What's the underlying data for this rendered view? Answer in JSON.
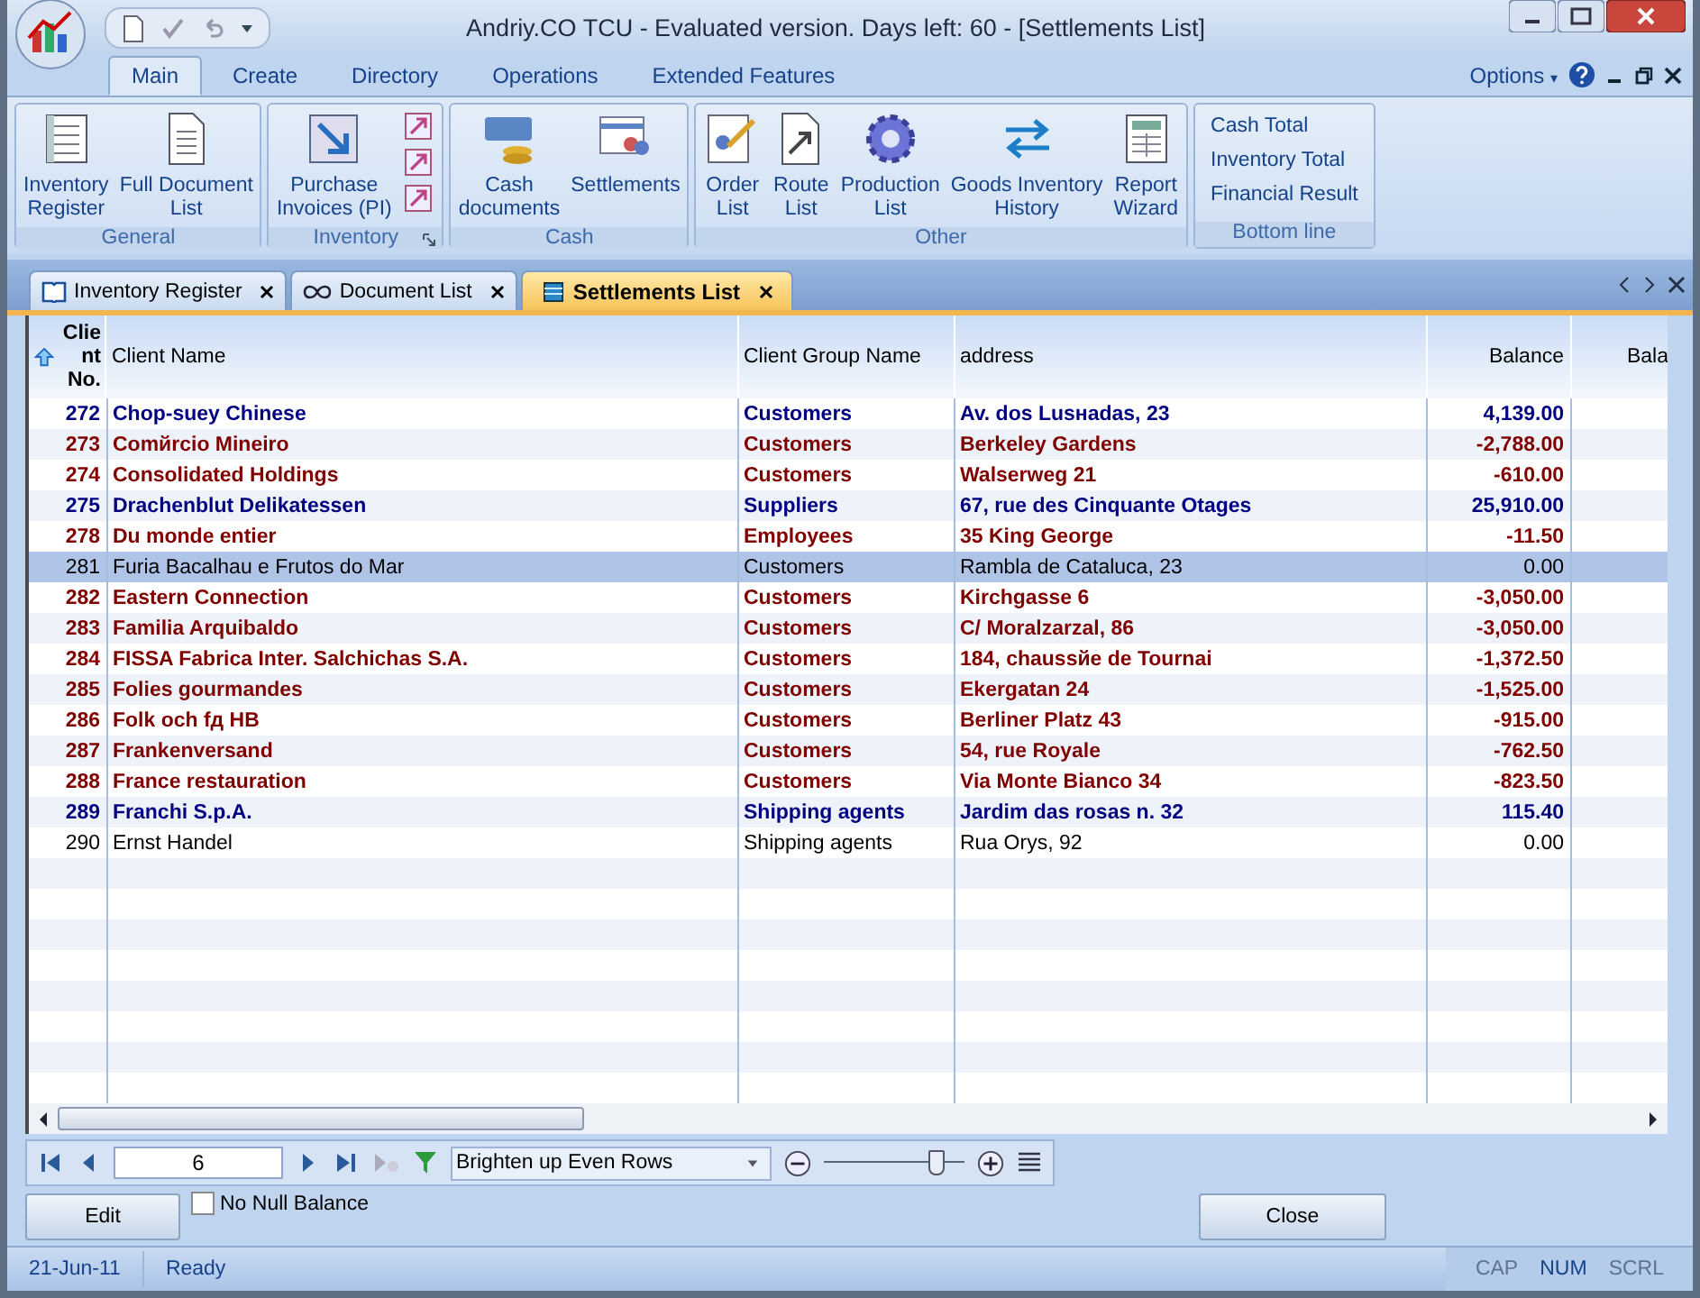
{
  "window": {
    "title": "Andriy.CO TCU - Evaluated version. Days left: 60 - [Settlements List]"
  },
  "ribbon_tabs": [
    {
      "label": "Main",
      "selected": true
    },
    {
      "label": "Create",
      "selected": false
    },
    {
      "label": "Directory",
      "selected": false
    },
    {
      "label": "Operations",
      "selected": false
    },
    {
      "label": "Extended Features",
      "selected": false
    }
  ],
  "options": {
    "label": "Options",
    "caret": "▾"
  },
  "ribbon_groups": [
    {
      "title": "General",
      "launcher": false,
      "buttons": [
        "Inventory\nRegister",
        "Full Document\nList"
      ]
    },
    {
      "title": "Inventory",
      "launcher": true,
      "buttons": [
        "Purchase\nInvoices (PI)"
      ]
    },
    {
      "title": "Cash",
      "launcher": false,
      "buttons": [
        "Cash\ndocuments",
        "Settlements"
      ]
    },
    {
      "title": "Other",
      "launcher": false,
      "buttons": [
        "Order\nList",
        "Route\nList",
        "Production\nList",
        "Goods Inventory\nHistory",
        "Report\nWizard"
      ]
    },
    {
      "title": "Bottom line",
      "launcher": false,
      "links": [
        "Cash Total",
        "Inventory Total",
        "Financial Result"
      ]
    }
  ],
  "doc_tabs": [
    {
      "label": "Inventory Register",
      "selected": false
    },
    {
      "label": "Document List",
      "selected": false
    },
    {
      "label": "Settlements List",
      "selected": true
    }
  ],
  "table": {
    "columns": [
      "Client No.",
      "Client Name",
      "Client Group Name",
      "address",
      "Balance",
      "Bala"
    ],
    "rows": [
      {
        "no": "272",
        "name": "Chop-suey Chinese",
        "group": "Customers",
        "address": "Av. dos Lusнadas, 23",
        "balance": "4,139.00",
        "color": "#000080",
        "bold": true,
        "selected": false
      },
      {
        "no": "273",
        "name": "Comйrcio Mineiro",
        "group": "Customers",
        "address": "Berkeley Gardens",
        "balance": "-2,788.00",
        "color": "#800000",
        "bold": true,
        "selected": false
      },
      {
        "no": "274",
        "name": "Consolidated Holdings",
        "group": "Customers",
        "address": "Walserweg 21",
        "balance": "-610.00",
        "color": "#800000",
        "bold": true,
        "selected": false
      },
      {
        "no": "275",
        "name": "Drachenblut Delikatessen",
        "group": "Suppliers",
        "address": "67, rue des Cinquante Otages",
        "balance": "25,910.00",
        "color": "#000080",
        "bold": true,
        "selected": false
      },
      {
        "no": "278",
        "name": "Du monde entier",
        "group": "Employees",
        "address": "35 King George",
        "balance": "-11.50",
        "color": "#800000",
        "bold": true,
        "selected": false
      },
      {
        "no": "281",
        "name": "Furia Bacalhau e Frutos do Mar",
        "group": "Customers",
        "address": "Rambla de Cataluca, 23",
        "balance": "0.00",
        "color": "#000000",
        "bold": false,
        "selected": true
      },
      {
        "no": "282",
        "name": "Eastern Connection",
        "group": "Customers",
        "address": "Kirchgasse 6",
        "balance": "-3,050.00",
        "color": "#800000",
        "bold": true,
        "selected": false
      },
      {
        "no": "283",
        "name": "Familia Arquibaldo",
        "group": "Customers",
        "address": "C/ Moralzarzal, 86",
        "balance": "-3,050.00",
        "color": "#800000",
        "bold": true,
        "selected": false
      },
      {
        "no": "284",
        "name": "FISSA Fabrica Inter. Salchichas S.A.",
        "group": "Customers",
        "address": "184, chaussйe de Tournai",
        "balance": "-1,372.50",
        "color": "#800000",
        "bold": true,
        "selected": false
      },
      {
        "no": "285",
        "name": "Folies gourmandes",
        "group": "Customers",
        "address": "Ekergatan 24",
        "balance": "-1,525.00",
        "color": "#800000",
        "bold": true,
        "selected": false
      },
      {
        "no": "286",
        "name": "Folk och fд HB",
        "group": "Customers",
        "address": "Berliner Platz 43",
        "balance": "-915.00",
        "color": "#800000",
        "bold": true,
        "selected": false
      },
      {
        "no": "287",
        "name": "Frankenversand",
        "group": "Customers",
        "address": "54, rue Royale",
        "balance": "-762.50",
        "color": "#800000",
        "bold": true,
        "selected": false
      },
      {
        "no": "288",
        "name": "France restauration",
        "group": "Customers",
        "address": "Via Monte Bianco 34",
        "balance": "-823.50",
        "color": "#800000",
        "bold": true,
        "selected": false
      },
      {
        "no": "289",
        "name": "Franchi S.p.A.",
        "group": "Shipping agents",
        "address": "Jardim das rosas n. 32",
        "balance": "115.40",
        "color": "#000080",
        "bold": true,
        "selected": false
      },
      {
        "no": "290",
        "name": "Ernst Handel",
        "group": "Shipping agents",
        "address": "Rua Orys, 92",
        "balance": "0.00",
        "color": "#000000",
        "bold": false,
        "selected": false
      }
    ]
  },
  "navigator": {
    "record": "6",
    "filter_mode": "Brighten up Even Rows",
    "zoom": {
      "level": 0.8
    }
  },
  "edit_button": "Edit",
  "no_null_balance": {
    "label": "No Null Balance",
    "checked": false
  },
  "close_button": "Close",
  "status_bar": {
    "date": "21-Jun-11",
    "state": "Ready",
    "keys": [
      {
        "label": "CAP",
        "on": false
      },
      {
        "label": "NUM",
        "on": true
      },
      {
        "label": "SCRL",
        "on": false
      }
    ]
  }
}
